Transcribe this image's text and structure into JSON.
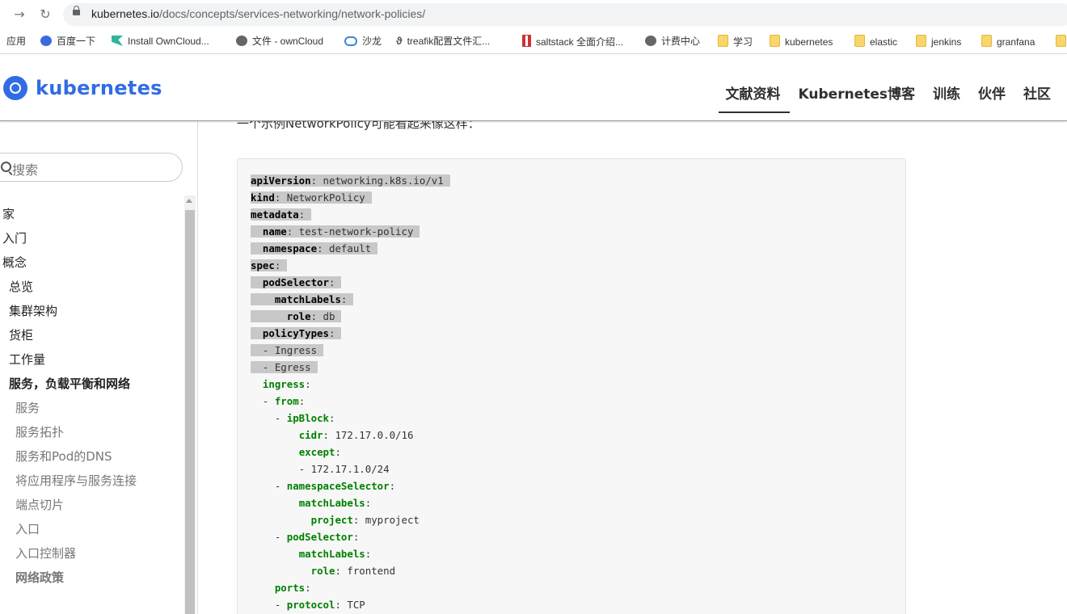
{
  "browser": {
    "url_host": "kubernetes.io",
    "url_path": "/docs/concepts/services-networking/network-policies/",
    "bookmarks": [
      {
        "label": "应用",
        "icon": "apps-icon"
      },
      {
        "label": "百度一下",
        "icon": "baidu-icon"
      },
      {
        "label": "Install OwnCloud...",
        "icon": "trello-icon"
      },
      {
        "label": "文件 - ownCloud",
        "icon": "globe-icon"
      },
      {
        "label": "沙龙",
        "icon": "cloud-icon"
      },
      {
        "label": "treafik配置文件汇...",
        "icon": "treafik-icon"
      },
      {
        "label": "saltstack 全面介绍...",
        "icon": "saltstack-icon"
      },
      {
        "label": "计费中心",
        "icon": "globe-icon"
      },
      {
        "label": "学习",
        "icon": "folder-icon"
      },
      {
        "label": "kubernetes",
        "icon": "folder-icon"
      },
      {
        "label": "elastic",
        "icon": "folder-icon"
      },
      {
        "label": "jenkins",
        "icon": "folder-icon"
      },
      {
        "label": "granfana",
        "icon": "folder-icon"
      }
    ]
  },
  "site": {
    "brand": "kubernetes",
    "nav": [
      "文献资料",
      "Kubernetes博客",
      "训练",
      "伙伴",
      "社区"
    ],
    "active_nav": "文献资料"
  },
  "sidebar": {
    "search_placeholder": "搜索",
    "items": [
      {
        "label": "家"
      },
      {
        "label": "入门"
      },
      {
        "label": "概念"
      },
      {
        "label": "总览"
      },
      {
        "label": "集群架构"
      },
      {
        "label": "货柜"
      },
      {
        "label": "工作量"
      },
      {
        "label": "服务，负载平衡和网络"
      },
      {
        "label": "服务"
      },
      {
        "label": "服务拓扑"
      },
      {
        "label": "服务和Pod的DNS"
      },
      {
        "label": "将应用程序与服务连接"
      },
      {
        "label": "端点切片"
      },
      {
        "label": "入口"
      },
      {
        "label": "入口控制器"
      },
      {
        "label": "网络政策"
      }
    ]
  },
  "main": {
    "intro": "一个示例NetworkPolicy可能看起来像这样：",
    "code_lines": [
      "apiVersion: networking.k8s.io/v1",
      "kind: NetworkPolicy",
      "metadata:",
      "  name: test-network-policy",
      "  namespace: default",
      "spec:",
      "  podSelector:",
      "    matchLabels:",
      "      role: db",
      "  policyTypes:",
      "  - Ingress",
      "  - Egress",
      "  ingress:",
      "  - from:",
      "    - ipBlock:",
      "        cidr: 172.17.0.0/16",
      "        except:",
      "        - 172.17.1.0/24",
      "    - namespaceSelector:",
      "        matchLabels:",
      "          project: myproject",
      "    - podSelector:",
      "        matchLabels:",
      "          role: frontend",
      "    ports:",
      "    - protocol: TCP"
    ],
    "selected_line_count": 12
  }
}
